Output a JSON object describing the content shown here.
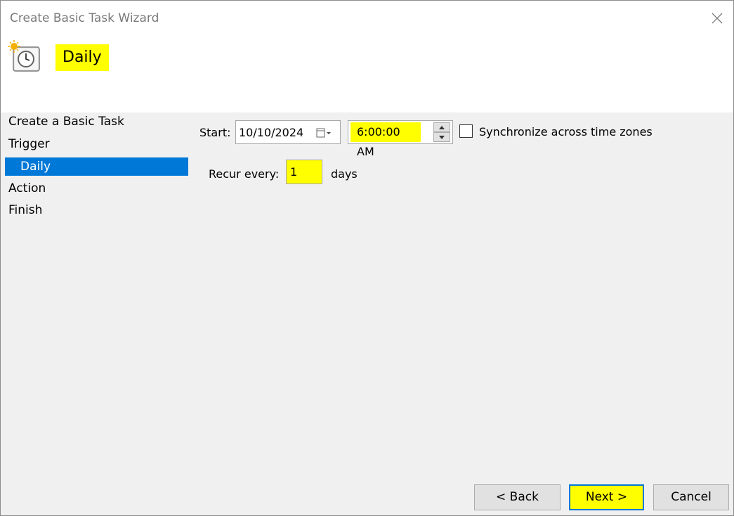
{
  "window": {
    "title": "Create Basic Task Wizard"
  },
  "header": {
    "title": "Daily",
    "icon": "scheduled-task-clock-icon"
  },
  "nav": {
    "items": [
      {
        "label": "Create a Basic Task"
      },
      {
        "label": "Trigger"
      },
      {
        "label": "Daily"
      },
      {
        "label": "Action"
      },
      {
        "label": "Finish"
      }
    ],
    "selected": "Daily"
  },
  "form": {
    "start_label": "Start:",
    "start_date": "10/10/2024",
    "start_time": "6:00:00 AM",
    "sync_label": "Synchronize across time zones",
    "sync_checked": false,
    "recur_label": "Recur every:",
    "recur_value": "1",
    "recur_unit": "days"
  },
  "buttons": {
    "back": "< Back",
    "next": "Next >",
    "cancel": "Cancel"
  },
  "colors": {
    "highlight": "#ffff00",
    "selection": "#0078d7",
    "panel": "#f0f0f0"
  }
}
